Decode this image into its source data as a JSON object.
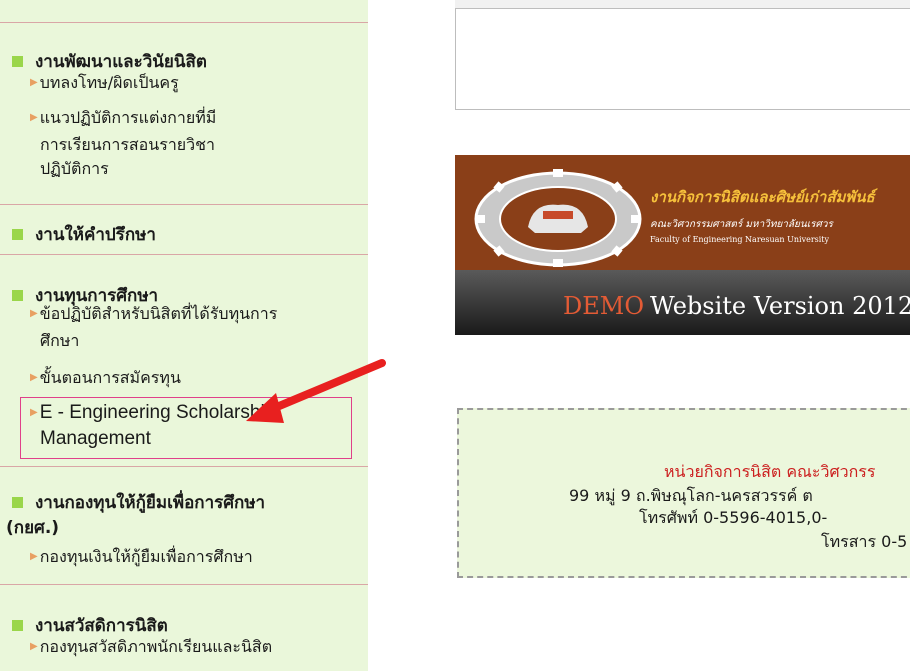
{
  "sidebar": {
    "sections": [
      {
        "title": "งานพัฒนาและวินัยนิสิต",
        "items": [
          "บทลงโทษ/ผิดเป็นครู",
          "แนวปฏิบัติการแต่งกายที่มี",
          "การเรียนการสอนรายวิชา",
          "ปฏิบัติการ"
        ]
      },
      {
        "title": "งานให้คำปรึกษา",
        "items": []
      },
      {
        "title": "งานทุนการศึกษา",
        "items": [
          "ข้อปฏิบัติสำหรับนิสิตที่ได้รับทุนการ",
          "ศึกษา",
          "ขั้นตอนการสมัครทุน",
          "E - Engineering Scholarship",
          "Management"
        ]
      },
      {
        "title": "งานกองทุนให้กู้ยืมเพื่อการศึกษา",
        "title_line2": "(กยศ.)",
        "items": [
          "กองทุนเงินให้กู้ยืมเพื่อการศึกษา"
        ]
      },
      {
        "title": "งานสวัสดิการนิสิต",
        "items": [
          "กองทุนสวัสดิภาพนักเรียนและนิสิต"
        ]
      }
    ]
  },
  "banner": {
    "title": "งานกิจการนิสิตและศิษย์เก่าสัมพันธ์",
    "faculty_th": "คณะวิศวกรรมศาสตร์ มหาวิทยาลัยนเรศวร",
    "faculty_en": "Faculty of Engineering Naresuan University",
    "demo": "DEMO",
    "version": "Website Version 2012"
  },
  "contact": {
    "unit": "หน่วยกิจการนิสิต คณะวิศวกรร",
    "address": "99 หมู่ 9 ถ.พิษณุโลก-นครสวรรค์ ต",
    "phone": "โทรศัพท์ 0-5596-4015,0-",
    "fax": "โทรสาร 0-5"
  },
  "colors": {
    "sidebar_bg": "#eaf7da",
    "bullet_square": "#9ad64a",
    "arrow_bullet": "#e8a062",
    "highlight_box": "#e0408a",
    "red_arrow": "#e8201f",
    "banner_brown": "#8a3f18",
    "demo_text": "#e35b35",
    "contact_red": "#cc1f1f"
  }
}
